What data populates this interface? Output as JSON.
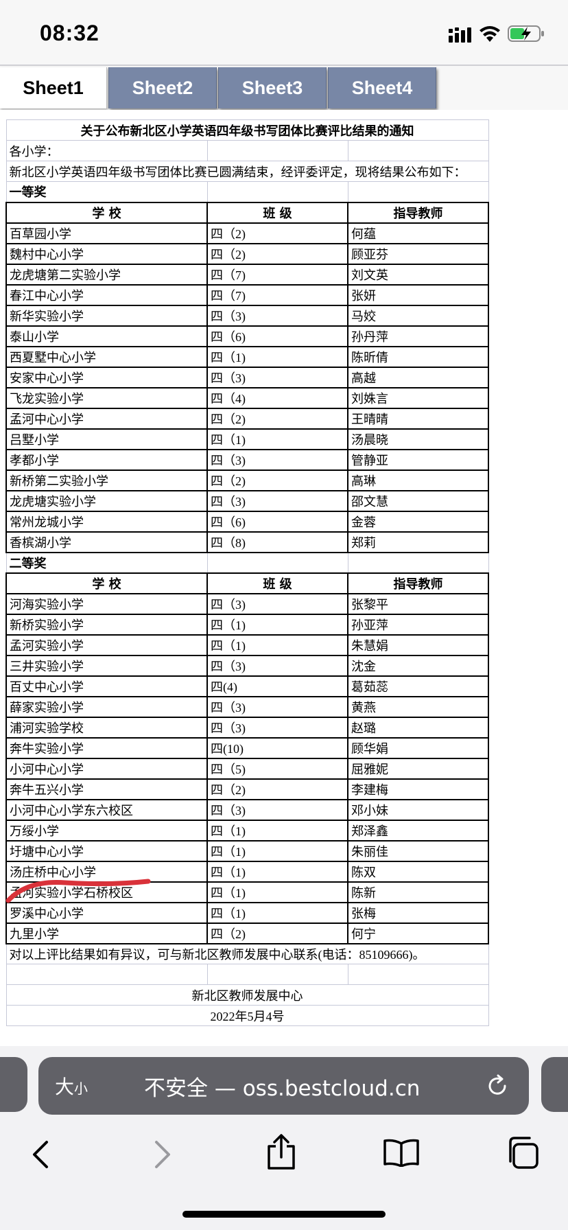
{
  "status": {
    "time": "08:32"
  },
  "tabs": [
    "Sheet1",
    "Sheet2",
    "Sheet3",
    "Sheet4"
  ],
  "doc": {
    "title": "关于公布新北区小学英语四年级书写团体比赛评比结果的通知",
    "salutation": "各小学：",
    "intro": "新北区小学英语四年级书写团体比赛已圆满结束，经评委评定，现将结果公布如下：",
    "headers": [
      "学 校",
      "班 级",
      "指导教师"
    ],
    "sections": [
      {
        "title": "一等奖",
        "rows": [
          [
            "百草园小学",
            "四（2)",
            "何蕴"
          ],
          [
            "魏村中心小学",
            "四（2)",
            "顾亚芬"
          ],
          [
            "龙虎塘第二实验小学",
            "四（7)",
            "刘文英"
          ],
          [
            "春江中心小学",
            "四（7)",
            "张妍"
          ],
          [
            "新华实验小学",
            "四（3)",
            "马姣"
          ],
          [
            "泰山小学",
            "四（6)",
            "孙丹萍"
          ],
          [
            "西夏墅中心小学",
            "四（1)",
            "陈昕倩"
          ],
          [
            "安家中心小学",
            "四（3)",
            "高越"
          ],
          [
            "飞龙实验小学",
            "四（4)",
            "刘姝言"
          ],
          [
            "孟河中心小学",
            "四（2)",
            "王晴晴"
          ],
          [
            "吕墅小学",
            "四（1)",
            "汤晨晓"
          ],
          [
            "孝都小学",
            "四（3)",
            "管静亚"
          ],
          [
            "新桥第二实验小学",
            "四（2)",
            "高琳"
          ],
          [
            "龙虎塘实验小学",
            "四（3)",
            "邵文慧"
          ],
          [
            "常州龙城小学",
            "四（6)",
            "金蓉"
          ],
          [
            "香槟湖小学",
            "四（8)",
            "郑莉"
          ]
        ]
      },
      {
        "title": "二等奖",
        "rows": [
          [
            "河海实验小学",
            "四（3)",
            "张黎平"
          ],
          [
            "新桥实验小学",
            "四（1)",
            "孙亚萍"
          ],
          [
            "孟河实验小学",
            "四（1)",
            "朱慧娟"
          ],
          [
            "三井实验小学",
            "四（3)",
            "沈金"
          ],
          [
            "百丈中心小学",
            "四(4)",
            "葛茹蕊"
          ],
          [
            "薛家实验小学",
            "四（3)",
            "黄燕"
          ],
          [
            "浦河实验学校",
            "四（3)",
            "赵璐"
          ],
          [
            "奔牛实验小学",
            "四(10)",
            "顾华娟"
          ],
          [
            "小河中心小学",
            "四（5)",
            "屈雅妮"
          ],
          [
            "奔牛五兴小学",
            "四（2)",
            "李建梅"
          ],
          [
            "小河中心小学东六校区",
            "四（3)",
            "邓小妹"
          ],
          [
            "万绥小学",
            "四（1)",
            "郑泽鑫"
          ],
          [
            "圩塘中心小学",
            "四（1)",
            "朱丽佳"
          ],
          [
            "汤庄桥中心小学",
            "四（1)",
            "陈双"
          ],
          [
            "孟河实验小学石桥校区",
            "四（1)",
            "陈新"
          ],
          [
            "罗溪中心小学",
            "四（1)",
            "张梅"
          ],
          [
            "九里小学",
            "四（2)",
            "何宁"
          ]
        ]
      }
    ],
    "note": "对以上评比结果如有异议，可与新北区教师发展中心联系(电话：85109666)。",
    "signature": "新北区教师发展中心",
    "date": "2022年5月4号"
  },
  "browser": {
    "text_size_label": "大",
    "text_size_small": "小",
    "url_display": "不安全 — oss.bestcloud.cn"
  },
  "colors": {
    "tab_inactive": "#7887a6",
    "url_bar": "#616167",
    "mark": "#d9323a"
  }
}
